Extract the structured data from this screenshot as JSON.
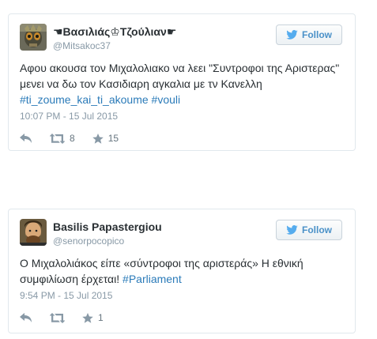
{
  "tweets": [
    {
      "fullname": "☚Βασιλιάς♔Τζούλιαν☛",
      "handle": "@Mitsakoc37",
      "follow_label": "Follow",
      "text_plain": "Αφου ακουσα τον Μιχαλολιακο να λεει \"Συντροφοι της Αριστερας\" μενει να δω τον Κασιδιαρη αγκαλια με τν Κανελλη",
      "hashtag1": "#ti_zoume_kai_ti_akoume",
      "hashtag2": "#vouli",
      "timestamp": "10:07 PM - 15 Jul 2015",
      "retweets": "8",
      "favorites": "15"
    },
    {
      "fullname": "Basilis Papastergiou",
      "handle": "@senorpocopico",
      "follow_label": "Follow",
      "text_plain": "Ο Μιχαλολιάκος είπε «σύντροφοι της αριστεράς» Η εθνική συμφιλίωση έρχεται!",
      "hashtag1": "#Parliament",
      "timestamp": "9:54 PM - 15 Jul 2015",
      "retweets": "",
      "favorites": "1"
    }
  ],
  "colors": {
    "link": "#2b7bb9",
    "follow_text": "#4a91c8",
    "meta": "#8899a6",
    "border": "#e1e8ed"
  },
  "icons": [
    "twitter-bird-icon",
    "reply-icon",
    "retweet-icon",
    "favorite-star-icon"
  ]
}
